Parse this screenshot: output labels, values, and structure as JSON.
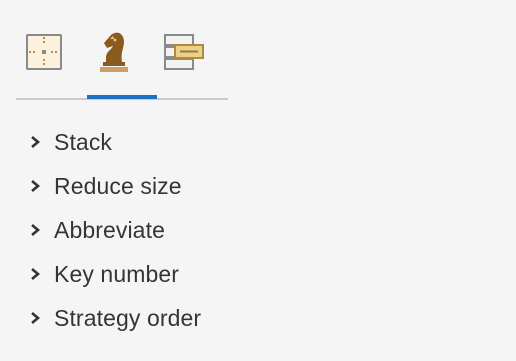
{
  "tabs": [
    {
      "icon": "layout-grid-icon",
      "active": false
    },
    {
      "icon": "chess-knight-icon",
      "active": true
    },
    {
      "icon": "stacked-panels-icon",
      "active": false
    }
  ],
  "colors": {
    "active_tab": "#1e6fc6",
    "icon_tan": "#e6c99a",
    "icon_brown": "#8b5a1f",
    "icon_gray": "#8a8a8a"
  },
  "options": [
    {
      "label": "Stack"
    },
    {
      "label": "Reduce size"
    },
    {
      "label": "Abbreviate"
    },
    {
      "label": "Key number"
    },
    {
      "label": "Strategy order"
    }
  ]
}
